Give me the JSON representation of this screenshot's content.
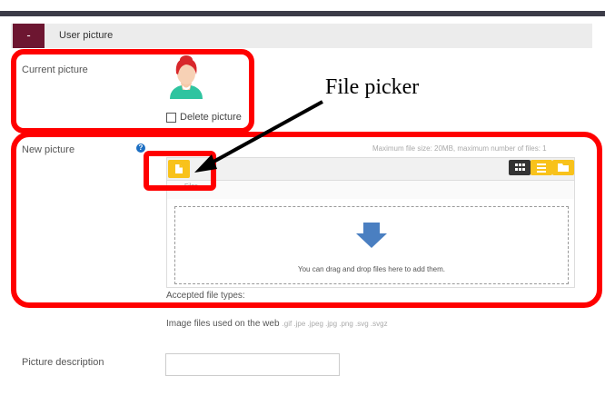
{
  "section": {
    "toggle_label": "-",
    "title": "User picture"
  },
  "current_picture": {
    "label": "Current picture",
    "delete_label": "Delete picture",
    "delete_checked": false
  },
  "new_picture": {
    "label": "New picture",
    "help_icon": "?",
    "max_info": "Maximum file size: 20MB, maximum number of files: 1",
    "filepicker": {
      "add_icon": "file-add-icon",
      "view_buttons": [
        {
          "icon": "grid-icon",
          "color": "#333333",
          "active": true
        },
        {
          "icon": "list-icon",
          "color": "#f8c21b",
          "active": false
        },
        {
          "icon": "folder-icon",
          "color": "#f8c21b",
          "active": false
        }
      ],
      "files_label": "Files",
      "drop_text": "You can drag and drop files here to add them."
    },
    "accepted_label": "Accepted file types:",
    "image_types_label": "Image files used on the web",
    "image_extensions": ".gif .jpe .jpeg .jpg .png .svg .svgz"
  },
  "picture_description": {
    "label": "Picture description",
    "value": ""
  },
  "annotation": {
    "callout_text": "File picker",
    "highlight_color": "#ff0000"
  },
  "colors": {
    "toggle_bg": "#6d1631",
    "accent_yellow": "#f8c21b",
    "drop_arrow": "#4a7fc1"
  }
}
